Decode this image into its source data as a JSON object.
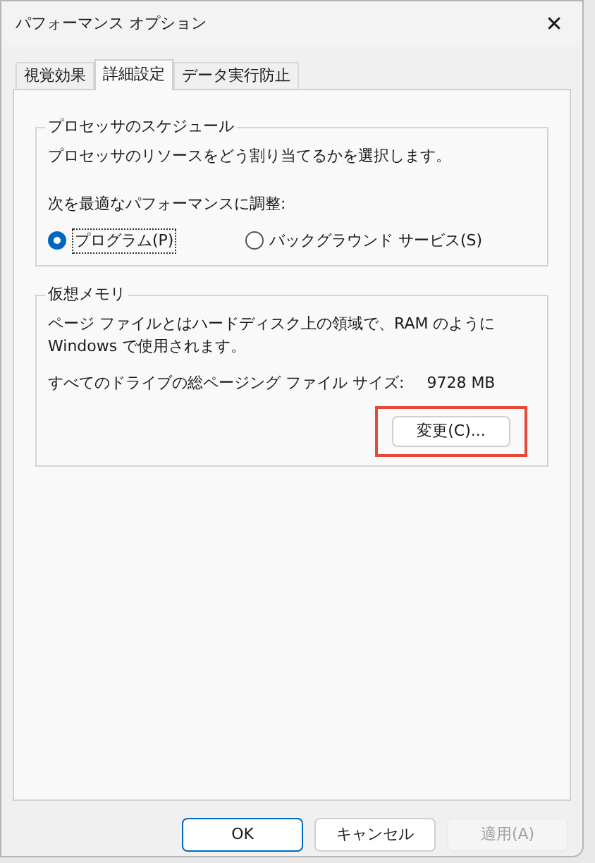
{
  "window": {
    "title": "パフォーマンス オプション",
    "close": "✕"
  },
  "tabs": [
    {
      "label": "視覚効果",
      "selected": false
    },
    {
      "label": "詳細設定",
      "selected": true
    },
    {
      "label": "データ実行防止",
      "selected": false
    }
  ],
  "processor_group": {
    "title": "プロセッサのスケジュール",
    "description": "プロセッサのリソースをどう割り当てるかを選択します。",
    "adjust_label": "次を最適なパフォーマンスに調整:",
    "options": [
      {
        "label": "プログラム(P)",
        "selected": true
      },
      {
        "label": "バックグラウンド サービス(S)",
        "selected": false
      }
    ]
  },
  "virtual_memory_group": {
    "title": "仮想メモリ",
    "description": "ページ ファイルとはハードディスク上の領域で、RAM のように Windows で使用されます。",
    "size_label": "すべてのドライブの総ページング ファイル サイズ:",
    "size_value": "9728 MB",
    "change_button": {
      "label": "変更(C)...",
      "highlighted": true
    }
  },
  "buttons": [
    {
      "label": "OK",
      "default": true,
      "disabled": false
    },
    {
      "label": "キャンセル",
      "default": false,
      "disabled": false
    },
    {
      "label": "適用(A)",
      "default": false,
      "disabled": true
    }
  ]
}
